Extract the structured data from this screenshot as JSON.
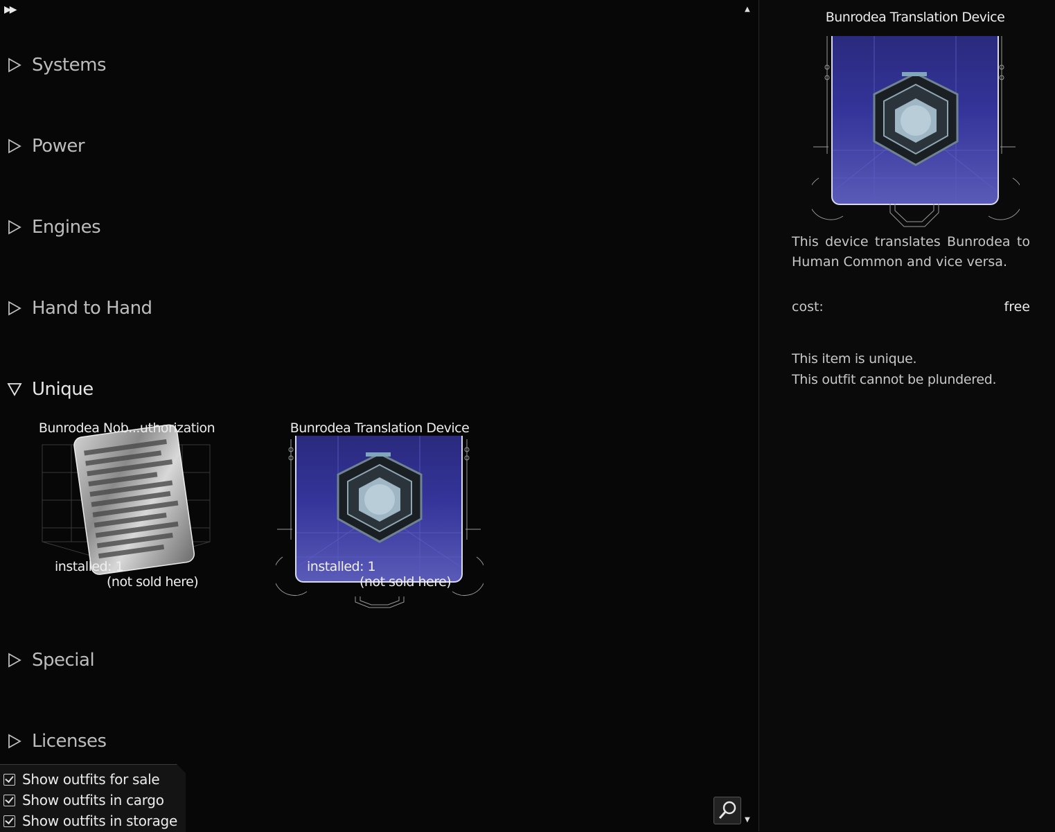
{
  "categories": [
    {
      "label": "Systems"
    },
    {
      "label": "Power"
    },
    {
      "label": "Engines"
    },
    {
      "label": "Hand to Hand"
    },
    {
      "label": "Unique"
    },
    {
      "label": "Special"
    },
    {
      "label": "Licenses"
    }
  ],
  "items": [
    {
      "name": "Bunrodea Nob...uthorization",
      "installed": "installed: 1",
      "availability": "(not sold here)"
    },
    {
      "name": "Bunrodea Translation Device",
      "installed": "installed: 1",
      "availability": "(not sold here)"
    }
  ],
  "detail": {
    "title": "Bunrodea Translation Device",
    "description": "This device translates Bunrodea to Human Common and vice versa.",
    "cost_label": "cost:",
    "cost_value": "free",
    "notes": [
      "This item is unique.",
      "This outfit cannot be plundered."
    ]
  },
  "filters": [
    {
      "label": "Show outfits for sale",
      "checked": true
    },
    {
      "label": "Show outfits in cargo",
      "checked": true
    },
    {
      "label": "Show outfits in storage",
      "checked": true
    }
  ],
  "icons": {
    "fast_forward": "fast-forward-icon",
    "search": "magnifier-icon",
    "collapsed": "triangle-right-icon",
    "expanded": "triangle-down-icon"
  },
  "colors": {
    "panel_blue": "#34349a",
    "background": "#070707"
  }
}
